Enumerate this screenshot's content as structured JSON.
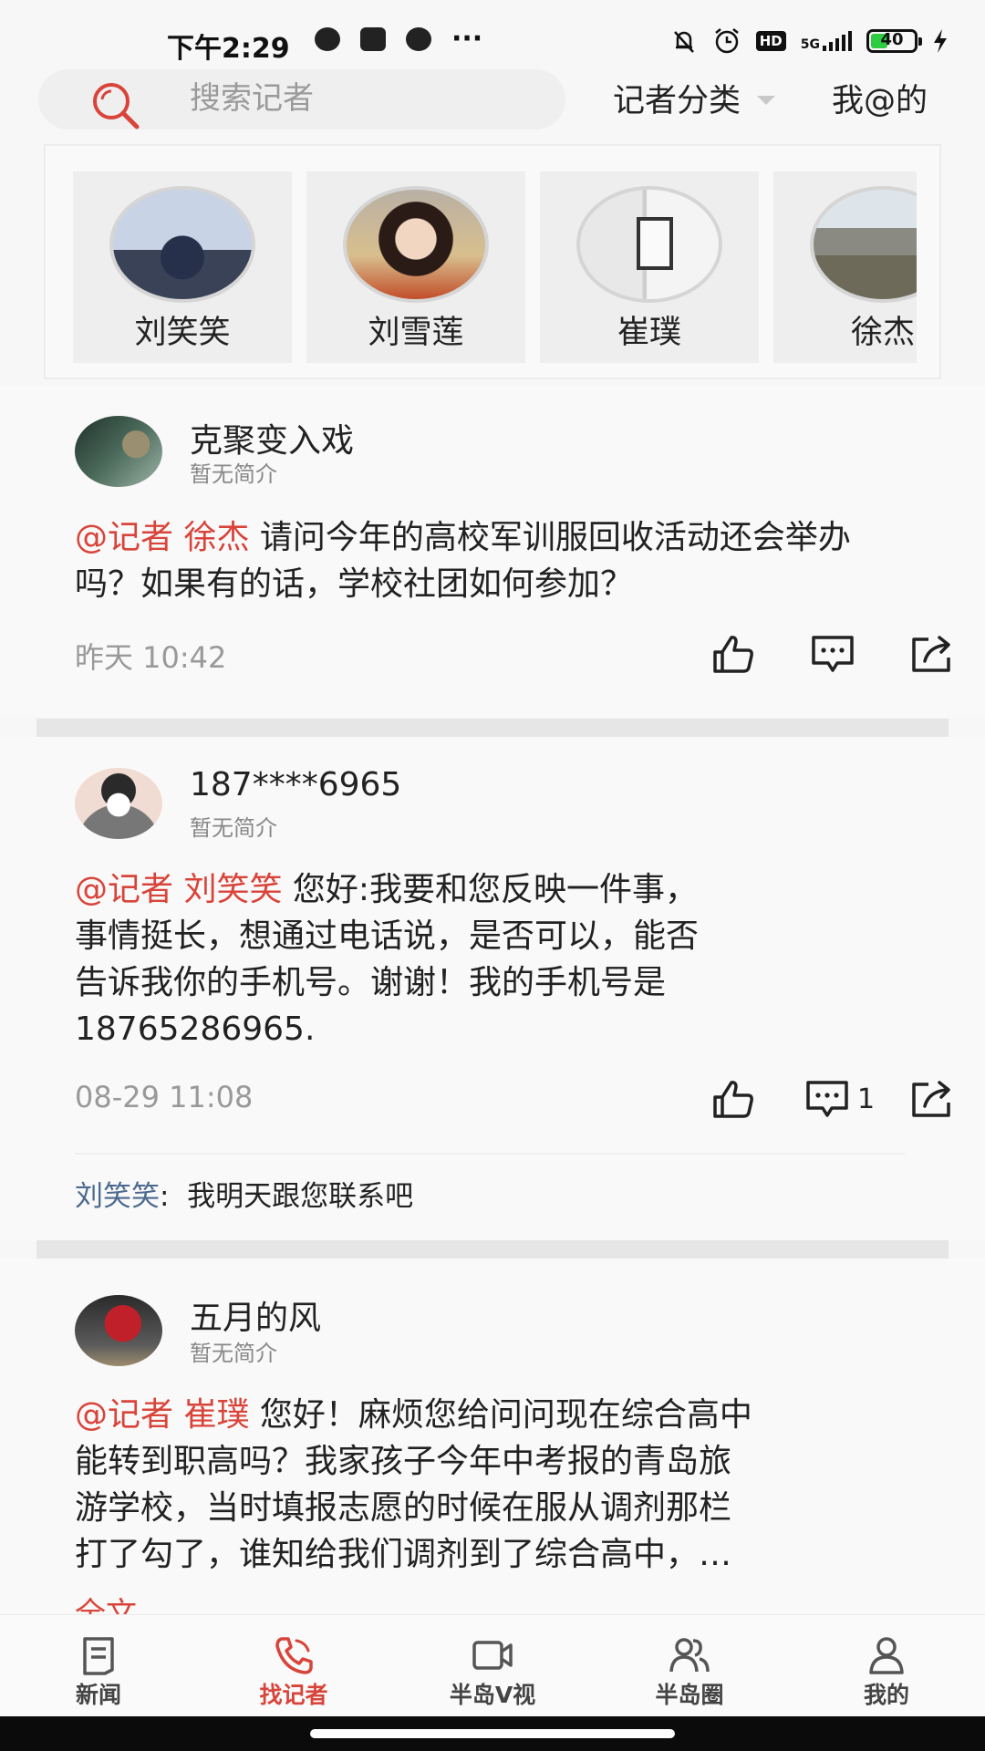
{
  "status_bar": {
    "time": "下午2:29",
    "battery_level": "40",
    "network_label": "5G",
    "hd_label": "HD",
    "icons": [
      "wechat-icon",
      "camera-icon",
      "message-icon",
      "more-dots-icon",
      "mute-bell-icon",
      "alarm-icon",
      "hd-icon",
      "signal-icon",
      "battery-icon",
      "charging-icon"
    ],
    "more_glyph": "···"
  },
  "header": {
    "search_placeholder": "搜索记者",
    "category_label": "记者分类",
    "mine_label": "我@的"
  },
  "reporters": [
    {
      "name": "刘笑笑"
    },
    {
      "name": "刘雪莲"
    },
    {
      "name": "崔璞"
    },
    {
      "name": "徐杰"
    }
  ],
  "posts": [
    {
      "user": "克聚变入戏",
      "bio": "暂无简介",
      "mention": "@记者 徐杰",
      "text": "请问今年的高校军训服回收活动还会举办吗？如果有的话，学校社团如何参加？",
      "time": "昨天 10:42",
      "comment_count": ""
    },
    {
      "user": "187****6965",
      "bio": "暂无简介",
      "mention": "@记者 刘笑笑",
      "text_line1": "您好:我要和您反映一件事，",
      "text_line2": "事情挺长，想通过电话说，是否可以，能否",
      "text_line3": "告诉我你的手机号。谢谢！我的手机号是",
      "text_line4": "18765286965.",
      "time": "08-29 11:08",
      "comment_count": "1",
      "reply_name": "刘笑笑",
      "reply_sep": ":",
      "reply_text": "我明天跟您联系吧"
    },
    {
      "user": "五月的风",
      "bio": "暂无简介",
      "mention": "@记者 崔璞",
      "text_line1": "您好！麻烦您给问问现在综合高中",
      "text_line2": "能转到职高吗？我家孩子今年中考报的青岛旅",
      "text_line3": "游学校，当时填报志愿的时候在服从调剂那栏",
      "text_line4": "打了勾了，谁知给我们调剂到了综合高中，…",
      "read_more": "全文"
    }
  ],
  "bottom_nav": [
    {
      "label": "新闻",
      "icon": "news-icon",
      "active": false
    },
    {
      "label": "找记者",
      "icon": "phone-icon",
      "active": true
    },
    {
      "label": "半岛V视",
      "icon": "video-icon",
      "active": false
    },
    {
      "label": "半岛圈",
      "icon": "people-icon",
      "active": false
    },
    {
      "label": "我的",
      "icon": "profile-icon",
      "active": false
    }
  ],
  "colors": {
    "accent": "#d9443a",
    "reply_name": "#4c6a8f",
    "background": "#f7f7f7"
  }
}
